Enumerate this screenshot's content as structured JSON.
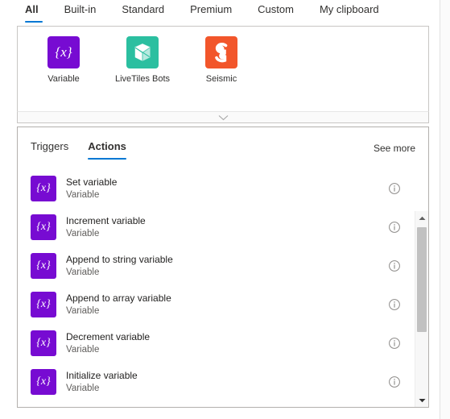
{
  "category_tabs": [
    {
      "label": "All",
      "selected": true
    },
    {
      "label": "Built-in",
      "selected": false
    },
    {
      "label": "Standard",
      "selected": false
    },
    {
      "label": "Premium",
      "selected": false
    },
    {
      "label": "Custom",
      "selected": false
    },
    {
      "label": "My clipboard",
      "selected": false
    }
  ],
  "connectors": [
    {
      "label": "Variable",
      "icon": "variable-braces-icon",
      "glyph": "{x}",
      "color": "#770bd2"
    },
    {
      "label": "LiveTiles Bots",
      "icon": "livetiles-cube-icon",
      "glyph": "",
      "color": "#2bbfa0"
    },
    {
      "label": "Seismic",
      "icon": "seismic-s-icon",
      "glyph": "S",
      "color": "#f2562b"
    }
  ],
  "collapse": {
    "icon": "chevron-down-icon"
  },
  "sub_tabs": [
    {
      "label": "Triggers",
      "selected": false
    },
    {
      "label": "Actions",
      "selected": true
    }
  ],
  "see_more_label": "See more",
  "actions": [
    {
      "title": "Set variable",
      "subtitle": "Variable",
      "glyph": "{x}",
      "info": "info-icon"
    },
    {
      "title": "Increment variable",
      "subtitle": "Variable",
      "glyph": "{x}",
      "info": "info-icon"
    },
    {
      "title": "Append to string variable",
      "subtitle": "Variable",
      "glyph": "{x}",
      "info": "info-icon"
    },
    {
      "title": "Append to array variable",
      "subtitle": "Variable",
      "glyph": "{x}",
      "info": "info-icon"
    },
    {
      "title": "Decrement variable",
      "subtitle": "Variable",
      "glyph": "{x}",
      "info": "info-icon"
    },
    {
      "title": "Initialize variable",
      "subtitle": "Variable",
      "glyph": "{x}",
      "info": "info-icon"
    }
  ],
  "scrollbar": {
    "up_icon": "scroll-up-arrow-icon",
    "down_icon": "scroll-down-arrow-icon"
  },
  "colors": {
    "accent": "#0078d4",
    "variable_purple": "#770bd2",
    "bots_teal": "#2bbfa0",
    "seismic_orange": "#f2562b"
  }
}
